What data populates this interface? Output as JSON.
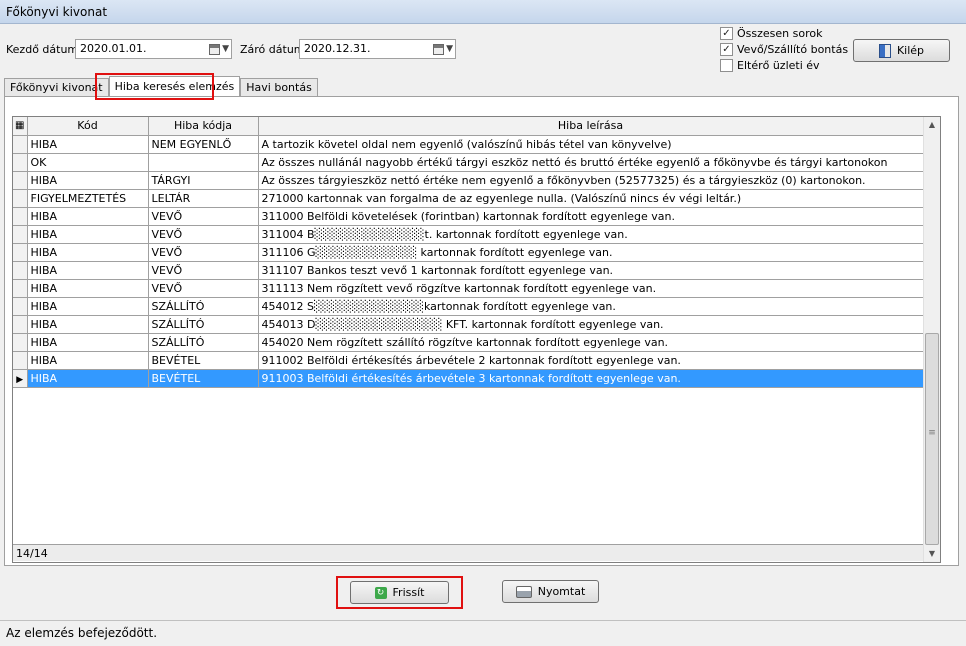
{
  "window": {
    "title": "Főkönyvi kivonat"
  },
  "filters": {
    "start_label": "Kezdő dátum:",
    "start_value": "2020.01.01.",
    "end_label": "Záró dátum:",
    "end_value": "2020.12.31."
  },
  "options": [
    {
      "label": "Összesen sorok",
      "checked": true
    },
    {
      "label": "Vevő/Szállító bontás",
      "checked": true
    },
    {
      "label": "Eltérő üzleti év",
      "checked": false
    }
  ],
  "exit_button": "Kilép",
  "tabs": [
    {
      "label": "Főkönyvi kivonat",
      "active": false
    },
    {
      "label": "Hiba keresés elemzés",
      "active": true
    },
    {
      "label": "Havi bontás",
      "active": false
    }
  ],
  "table": {
    "columns": [
      "Kód",
      "Hiba kódja",
      "Hiba leírása"
    ],
    "rows": [
      [
        "HIBA",
        "NEM EGYENLŐ",
        "A tartozik követel oldal nem egyenlő (valószínű hibás tétel van könyvelve)"
      ],
      [
        "OK",
        "",
        "Az összes nullánál nagyobb értékű tárgyi eszköz nettó és bruttó értéke egyenlő a főkönyvbe és tárgyi kartonokon"
      ],
      [
        "HIBA",
        "TÁRGYI",
        "Az összes tárgyieszköz nettó értéke nem egyenlő a főkönyvben (52577325) és a tárgyieszköz (0) kartonokon."
      ],
      [
        "FIGYELMEZTETÉS",
        "LELTÁR",
        "271000 kartonnak van forgalma de az egyenlege nulla. (Valószínű nincs év végi leltár.)"
      ],
      [
        "HIBA",
        "VEVŐ",
        "311000 Belföldi követelések (forintban) kartonnak fordított egyenlege van."
      ],
      [
        "HIBA",
        "VEVŐ",
        "311004 B░░░░░░░░░░░░░t. kartonnak fordított egyenlege van."
      ],
      [
        "HIBA",
        "VEVŐ",
        "311106 G░░░░░░░░░░░░ kartonnak fordított egyenlege van."
      ],
      [
        "HIBA",
        "VEVŐ",
        "311107 Bankos teszt vevő 1 kartonnak fordított egyenlege van."
      ],
      [
        "HIBA",
        "VEVŐ",
        "311113 Nem rögzített vevő rögzítve kartonnak fordított egyenlege van."
      ],
      [
        "HIBA",
        "SZÁLLÍTÓ",
        "454012 S░░░░░░░░░░░░░kartonnak fordított egyenlege van."
      ],
      [
        "HIBA",
        "SZÁLLÍTÓ",
        "454013 D░░░░░░░░░░░░░░░ KFT. kartonnak fordított egyenlege van."
      ],
      [
        "HIBA",
        "SZÁLLÍTÓ",
        "454020 Nem rögzített szállító rögzítve kartonnak fordított egyenlege van."
      ],
      [
        "HIBA",
        "BEVÉTEL",
        "911002 Belföldi értékesítés árbevétele 2 kartonnak fordított egyenlege van."
      ],
      [
        "HIBA",
        "BEVÉTEL",
        "911003 Belföldi értékesítés árbevétele 3 kartonnak fordított egyenlege van."
      ]
    ],
    "selected_row": 13,
    "record_count": "14/14"
  },
  "buttons": {
    "refresh": "Frissít",
    "print": "Nyomtat"
  },
  "status": "Az elemzés befejeződött."
}
